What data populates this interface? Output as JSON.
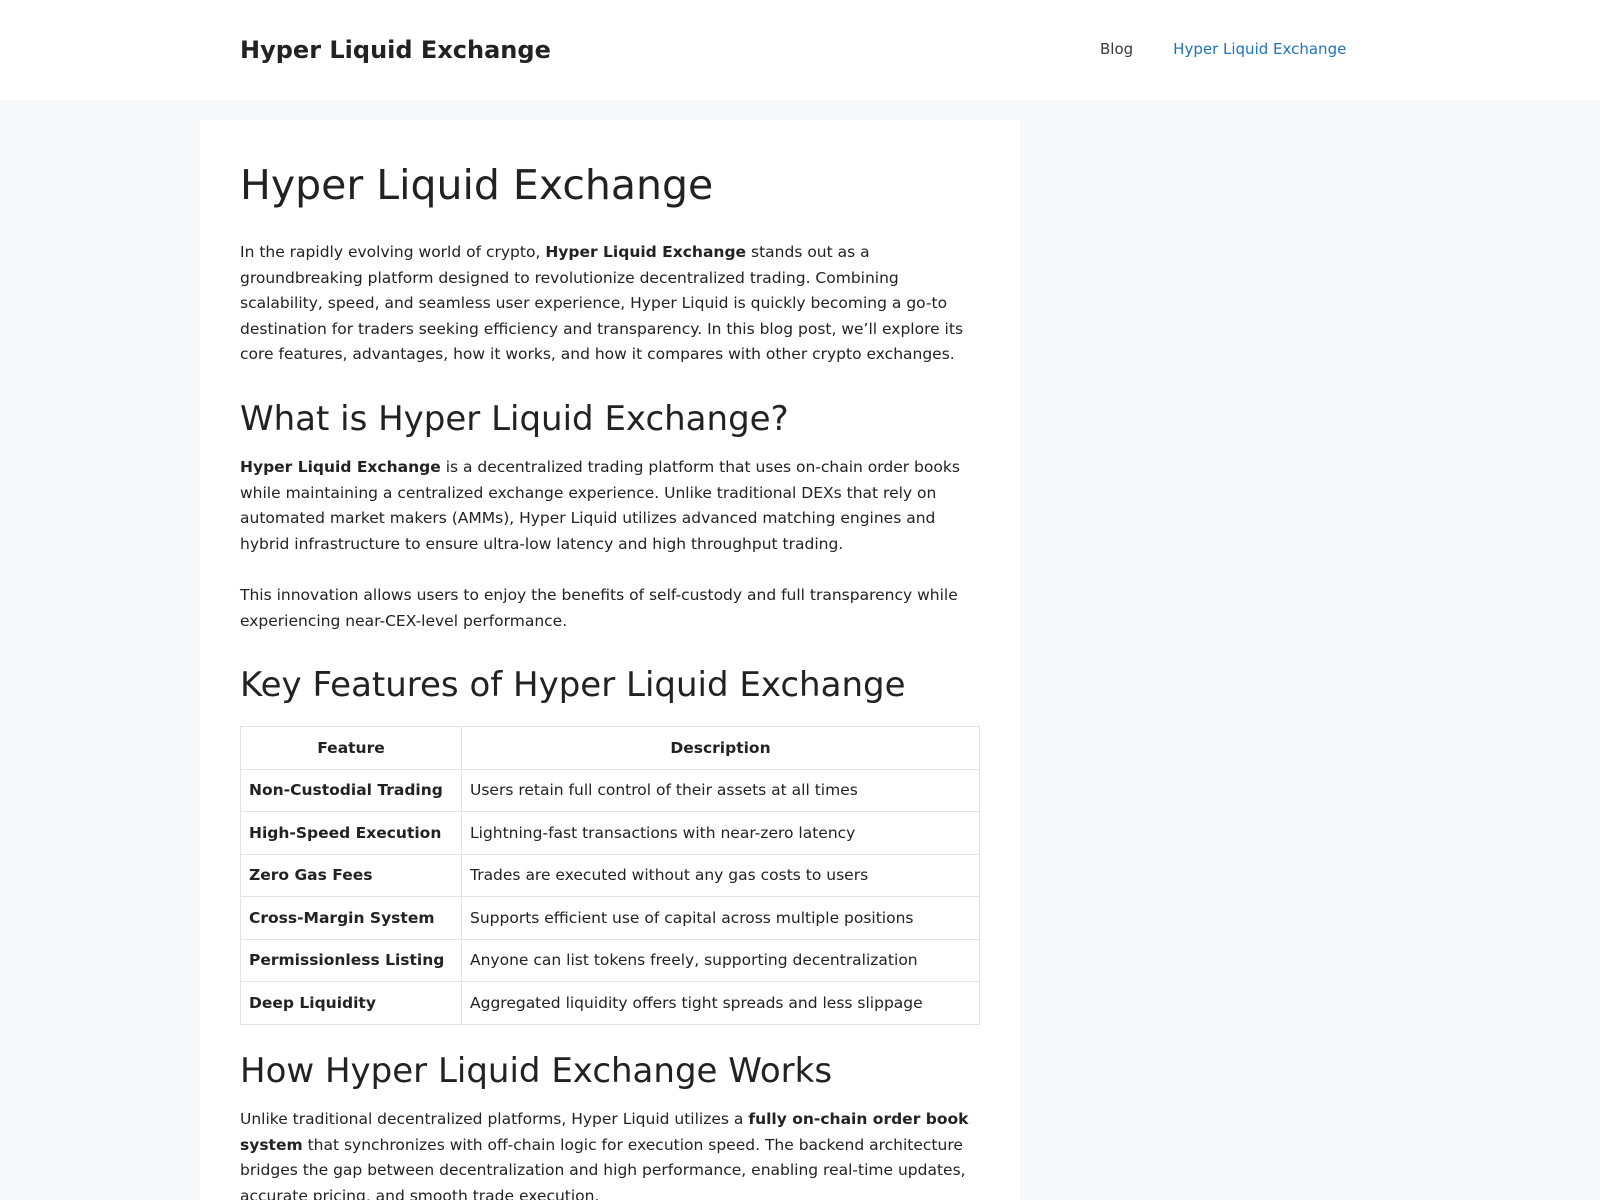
{
  "header": {
    "site_title": "Hyper Liquid Exchange",
    "nav": [
      {
        "label": "Blog"
      },
      {
        "label": "Hyper Liquid Exchange"
      }
    ]
  },
  "article": {
    "title": "Hyper Liquid Exchange",
    "intro": {
      "before": "In the rapidly evolving world of crypto, ",
      "bold": "Hyper Liquid Exchange",
      "after": " stands out as a groundbreaking platform designed to revolutionize decentralized trading. Combining scalability, speed, and seamless user experience, Hyper Liquid is quickly becoming a go-to destination for traders seeking efficiency and transparency. In this blog post, we’ll explore its core features, advantages, how it works, and how it compares with other crypto exchanges."
    },
    "section1": {
      "heading": "What is Hyper Liquid Exchange?",
      "para1": {
        "bold": "Hyper Liquid Exchange",
        "after": " is a decentralized trading platform that uses on-chain order books while maintaining a centralized exchange experience. Unlike traditional DEXs that rely on automated market makers (AMMs), Hyper Liquid utilizes advanced matching engines and hybrid infrastructure to ensure ultra-low latency and high throughput trading."
      },
      "para2": "This innovation allows users to enjoy the benefits of self-custody and full transparency while experiencing near-CEX-level performance."
    },
    "section2": {
      "heading": "Key Features of Hyper Liquid Exchange",
      "table": {
        "headers": [
          "Feature",
          "Description"
        ],
        "rows": [
          {
            "feature": "Non-Custodial Trading",
            "description": "Users retain full control of their assets at all times"
          },
          {
            "feature": "High-Speed Execution",
            "description": "Lightning-fast transactions with near-zero latency"
          },
          {
            "feature": "Zero Gas Fees",
            "description": "Trades are executed without any gas costs to users"
          },
          {
            "feature": "Cross-Margin System",
            "description": "Supports efficient use of capital across multiple positions"
          },
          {
            "feature": "Permissionless Listing",
            "description": "Anyone can list tokens freely, supporting decentralization"
          },
          {
            "feature": "Deep Liquidity",
            "description": "Aggregated liquidity offers tight spreads and less slippage"
          }
        ]
      }
    },
    "section3": {
      "heading": "How Hyper Liquid Exchange Works",
      "para1": {
        "before": "Unlike traditional decentralized platforms, Hyper Liquid utilizes a ",
        "bold": "fully on-chain order book system",
        "after": " that synchronizes with off-chain logic for execution speed. The backend architecture bridges the gap between decentralization and high performance, enabling real-time updates, accurate pricing, and smooth trade execution."
      }
    }
  }
}
